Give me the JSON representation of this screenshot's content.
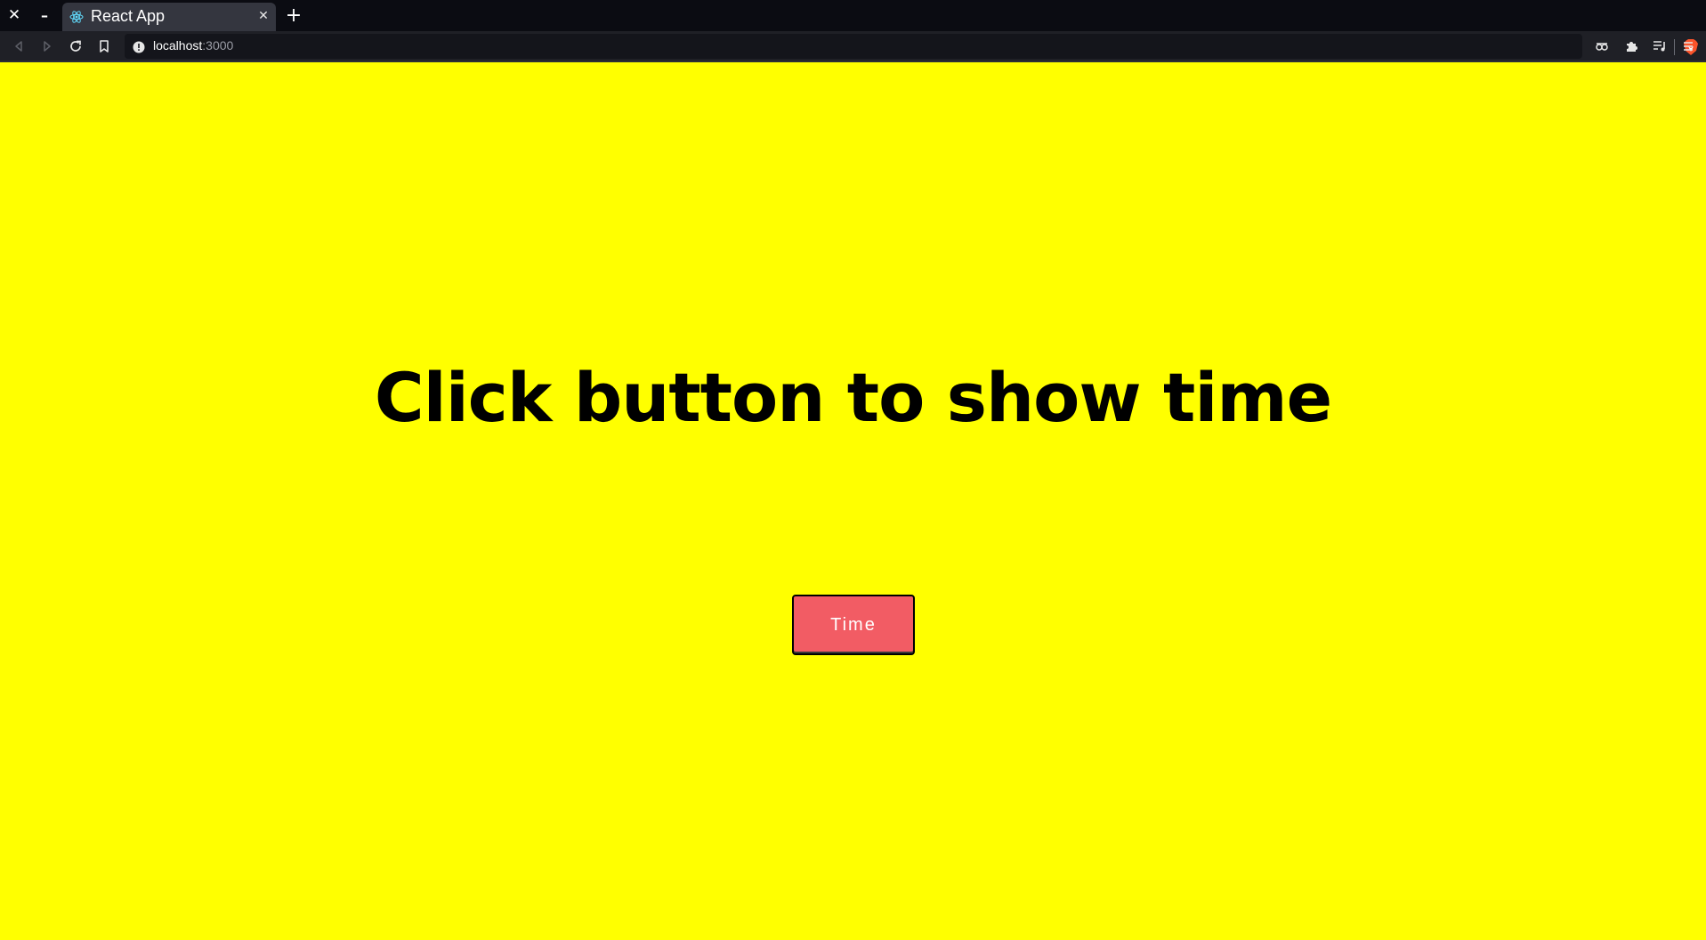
{
  "browser": {
    "tab_title": "React App",
    "address_host": "localhost",
    "address_port": ":3000"
  },
  "page": {
    "heading": "Click button to show time",
    "button_label": "Time"
  },
  "colors": {
    "page_background": "#ffff00",
    "button_background": "#f25c64",
    "heading_text": "#000000"
  },
  "icons": {
    "window_close": "close-icon",
    "window_minimize": "minimize-icon",
    "tab_favicon": "react-icon",
    "new_tab": "plus-icon",
    "back": "back-arrow-icon",
    "forward": "forward-arrow-icon",
    "reload": "reload-icon",
    "bookmark": "bookmark-icon",
    "site_info": "info-icon",
    "brave_shields": "brave-lion-icon",
    "wallet": "wallet-icon",
    "extensions": "puzzle-icon",
    "playlist": "playlist-icon",
    "menu": "menu-icon"
  }
}
